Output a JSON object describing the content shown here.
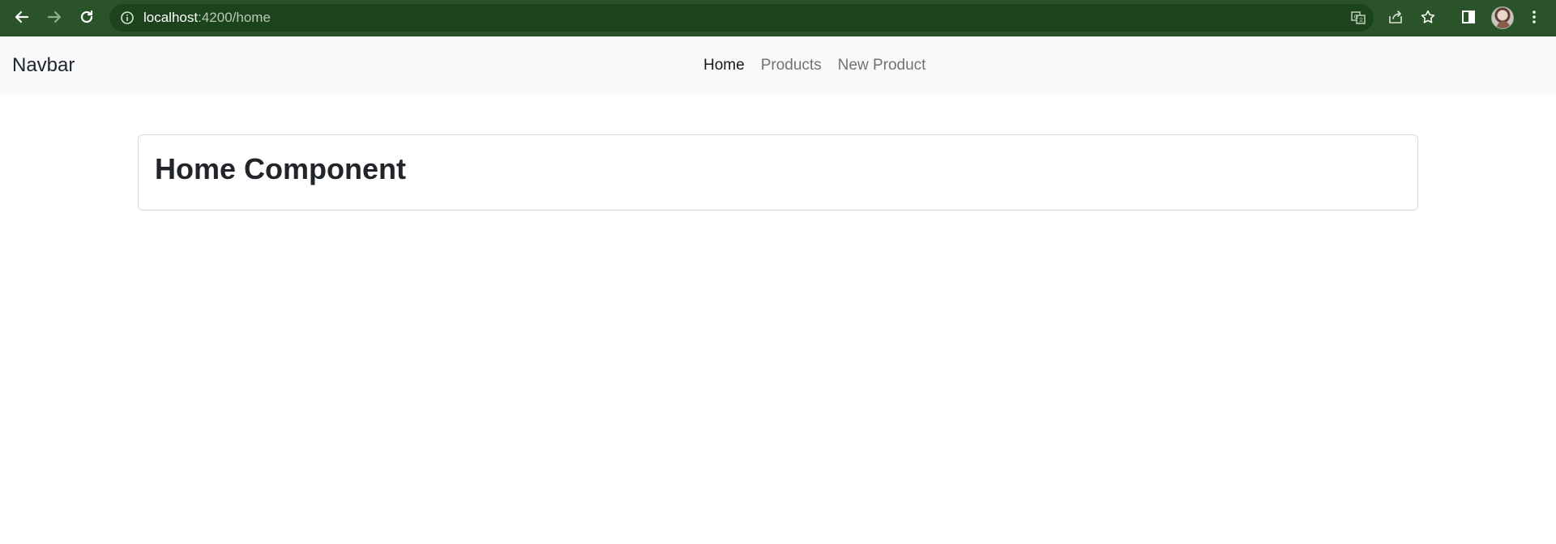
{
  "browser": {
    "url_host": "localhost",
    "url_path": ":4200/home",
    "icons": [
      "back-arrow-icon",
      "forward-arrow-icon",
      "reload-icon",
      "info-icon",
      "translate-icon",
      "share-icon",
      "star-icon",
      "side-panel-icon",
      "avatar",
      "more-vert-icon"
    ],
    "colors": {
      "toolbar": "#2a5329",
      "omnibox": "#1d431d"
    }
  },
  "navbar": {
    "brand": "Navbar",
    "links": [
      {
        "label": "Home",
        "active": true
      },
      {
        "label": "Products",
        "active": false
      },
      {
        "label": "New Product",
        "active": false
      }
    ]
  },
  "main": {
    "card_title": "Home Component"
  }
}
